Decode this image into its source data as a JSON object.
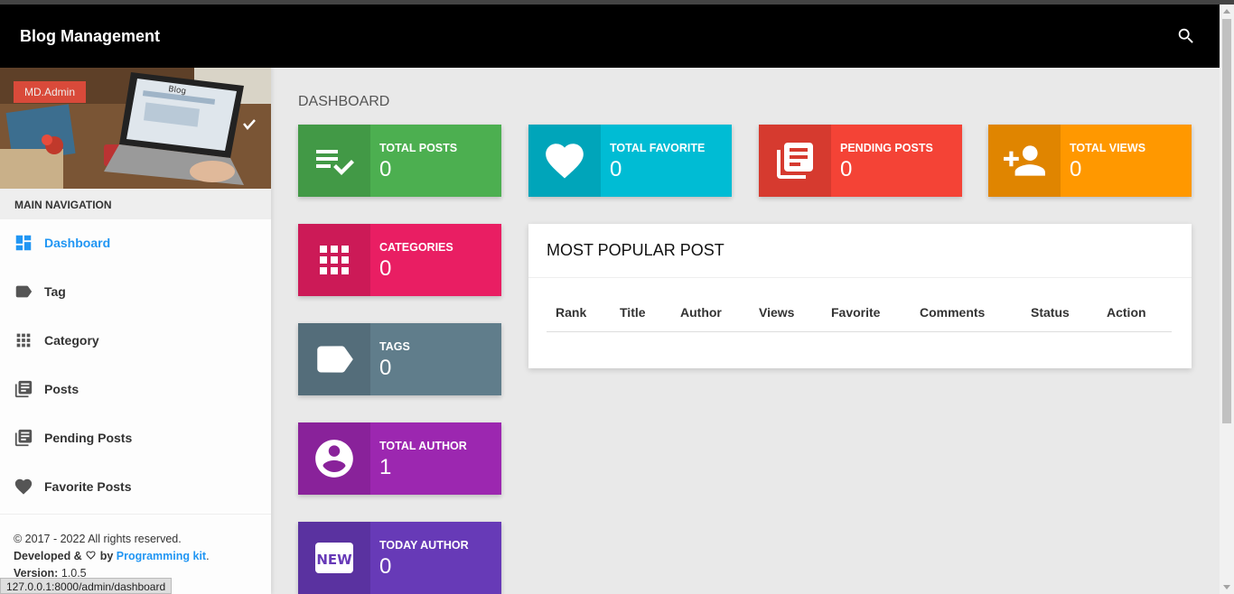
{
  "navbar": {
    "brand": "Blog Management",
    "search_icon": "search-icon"
  },
  "sidebar": {
    "user_name": "MD.Admin",
    "nav_header": "MAIN NAVIGATION",
    "items": [
      {
        "label": "Dashboard",
        "icon": "dashboard-icon",
        "active": true
      },
      {
        "label": "Tag",
        "icon": "label-icon"
      },
      {
        "label": "Category",
        "icon": "apps-icon"
      },
      {
        "label": "Posts",
        "icon": "library-books-icon"
      },
      {
        "label": "Pending Posts",
        "icon": "library-books-icon"
      },
      {
        "label": "Favorite Posts",
        "icon": "heart-icon"
      }
    ],
    "legal": {
      "copyright": "© 2017 - 2022 All rights reserved.",
      "developed_prefix": "Developed &",
      "developed_by": "by",
      "developer": "Programming kit",
      "developer_suffix": ".",
      "version_label": "Version:",
      "version": "1.0.5"
    }
  },
  "status_bar": {
    "url": "127.0.0.1:8000/admin/dashboard"
  },
  "content": {
    "title": "DASHBOARD",
    "boxes": [
      {
        "label": "TOTAL POSTS",
        "value": "0",
        "icon": "playlist-add-check-icon",
        "color": "#4caf50"
      },
      {
        "label": "TOTAL FAVORITE",
        "value": "0",
        "icon": "heart-icon",
        "color": "#00bcd4"
      },
      {
        "label": "PENDING POSTS",
        "value": "0",
        "icon": "library-books-icon",
        "color": "#f44336"
      },
      {
        "label": "TOTAL VIEWS",
        "value": "0",
        "icon": "person-add-icon",
        "color": "#ff9800"
      },
      {
        "label": "CATEGORIES",
        "value": "0",
        "icon": "apps-icon",
        "color": "#e91e63"
      },
      {
        "label": "TAGS",
        "value": "0",
        "icon": "label-icon",
        "color": "#607d8b"
      },
      {
        "label": "TOTAL AUTHOR",
        "value": "1",
        "icon": "account-circle-icon",
        "color": "#9c27b0"
      },
      {
        "label": "TODAY AUTHOR",
        "value": "0",
        "icon": "new-badge-icon",
        "color": "#673ab7"
      }
    ],
    "popular": {
      "title": "MOST POPULAR POST",
      "columns": [
        "Rank",
        "Title",
        "Author",
        "Views",
        "Favorite",
        "Comments",
        "Status",
        "Action"
      ],
      "rows": []
    }
  }
}
